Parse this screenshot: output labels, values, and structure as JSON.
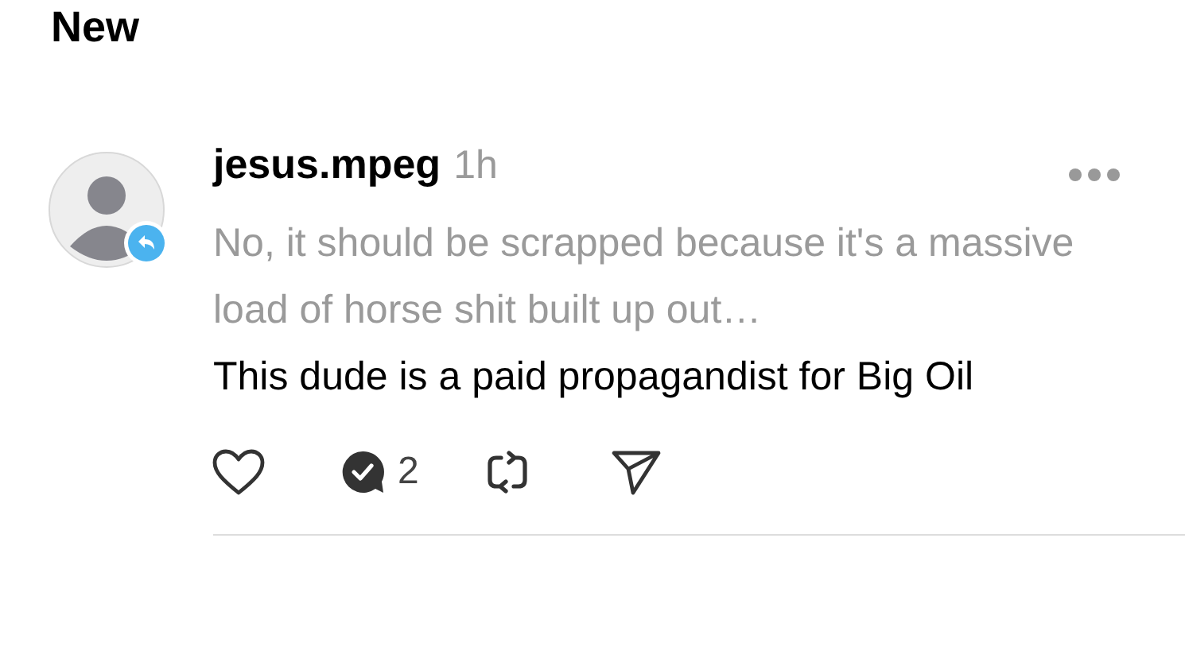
{
  "section_title": "New",
  "notification": {
    "username": "jesus.mpeg",
    "time": "1h",
    "quoted_text": "No, it should be scrapped because it's a massive load of horse shit built up out…",
    "reply_text": "This dude is a paid propagandist for Big Oil",
    "replied": true,
    "reply_count": "2",
    "liked": false
  }
}
